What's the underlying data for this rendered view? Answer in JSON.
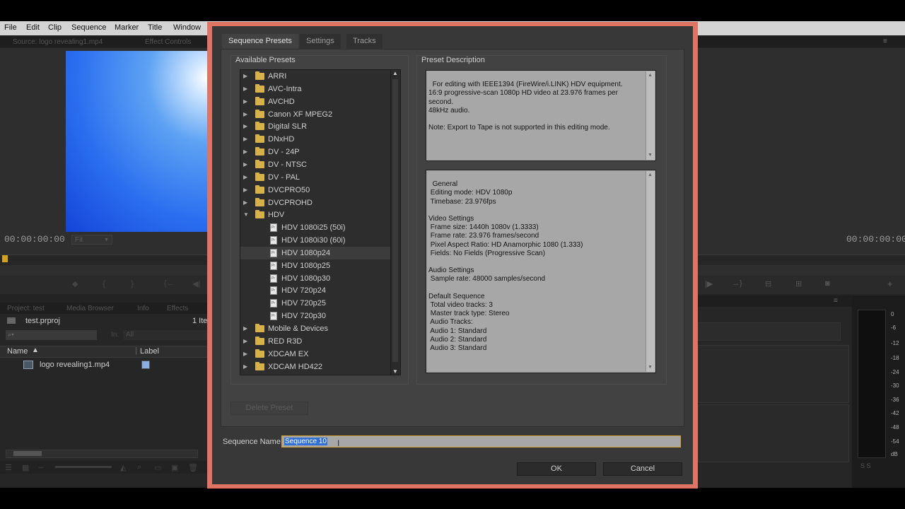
{
  "menubar": {
    "items": [
      "File",
      "Edit",
      "Clip",
      "Sequence",
      "Marker",
      "Title",
      "Window"
    ]
  },
  "source_panel": {
    "tab": "Source: logo revealing1.mp4",
    "tab2": "Effect Controls",
    "timecode": "00:00:00:00",
    "fit": "Fit"
  },
  "program_panel": {
    "timecode": "00:00:00:00"
  },
  "project_panel": {
    "tabs": [
      "Project: test",
      "Media Browser",
      "Info",
      "Effects"
    ],
    "project_file": "test.prproj",
    "item_count": "1 Ite",
    "in_label": "In:",
    "in_value": "All",
    "col_name": "Name",
    "col_label": "Label",
    "items": [
      {
        "name": "logo revealing1.mp4",
        "label_color": "#8aaee6"
      }
    ]
  },
  "meter": {
    "ticks": [
      "0",
      "-6",
      "-12",
      "-18",
      "-24",
      "-30",
      "-36",
      "-42",
      "-48",
      "-54",
      "dB"
    ]
  },
  "dialog": {
    "tabs": [
      "Sequence Presets",
      "Settings",
      "Tracks"
    ],
    "available_presets_label": "Available Presets",
    "preset_description_label": "Preset Description",
    "tree": [
      {
        "label": "ARRI",
        "kind": "folder",
        "expanded": false
      },
      {
        "label": "AVC-Intra",
        "kind": "folder",
        "expanded": false
      },
      {
        "label": "AVCHD",
        "kind": "folder",
        "expanded": false
      },
      {
        "label": "Canon XF MPEG2",
        "kind": "folder",
        "expanded": false
      },
      {
        "label": "Digital SLR",
        "kind": "folder",
        "expanded": false
      },
      {
        "label": "DNxHD",
        "kind": "folder",
        "expanded": false
      },
      {
        "label": "DV - 24P",
        "kind": "folder",
        "expanded": false
      },
      {
        "label": "DV - NTSC",
        "kind": "folder",
        "expanded": false
      },
      {
        "label": "DV - PAL",
        "kind": "folder",
        "expanded": false
      },
      {
        "label": "DVCPRO50",
        "kind": "folder",
        "expanded": false
      },
      {
        "label": "DVCPROHD",
        "kind": "folder",
        "expanded": false
      },
      {
        "label": "HDV",
        "kind": "folder",
        "expanded": true
      },
      {
        "label": "HDV 1080i25 (50i)",
        "kind": "preset"
      },
      {
        "label": "HDV 1080i30 (60i)",
        "kind": "preset"
      },
      {
        "label": "HDV 1080p24",
        "kind": "preset",
        "selected": true
      },
      {
        "label": "HDV 1080p25",
        "kind": "preset"
      },
      {
        "label": "HDV 1080p30",
        "kind": "preset"
      },
      {
        "label": "HDV 720p24",
        "kind": "preset"
      },
      {
        "label": "HDV 720p25",
        "kind": "preset"
      },
      {
        "label": "HDV 720p30",
        "kind": "preset"
      },
      {
        "label": "Mobile & Devices",
        "kind": "folder",
        "expanded": false
      },
      {
        "label": "RED R3D",
        "kind": "folder",
        "expanded": false
      },
      {
        "label": "XDCAM EX",
        "kind": "folder",
        "expanded": false
      },
      {
        "label": "XDCAM HD422",
        "kind": "folder",
        "expanded": false
      }
    ],
    "description": "For editing with IEEE1394 (FireWire/i.LINK) HDV equipment.\n16:9 progressive-scan 1080p HD video at 23.976 frames per\nsecond.\n48kHz audio.\n\nNote: Export to Tape is not supported in this editing mode.",
    "details": "General\n Editing mode: HDV 1080p\n Timebase: 23.976fps\n\nVideo Settings\n Frame size: 1440h 1080v (1.3333)\n Frame rate: 23.976 frames/second\n Pixel Aspect Ratio: HD Anamorphic 1080 (1.333)\n Fields: No Fields (Progressive Scan)\n\nAudio Settings\n Sample rate: 48000 samples/second\n\nDefault Sequence\n Total video tracks: 3\n Master track type: Stereo\n Audio Tracks:\n Audio 1: Standard\n Audio 2: Standard\n Audio 3: Standard",
    "delete_preset": "Delete Preset",
    "sequence_name_label": "Sequence Name:",
    "sequence_name_value": "Sequence 10",
    "ok": "OK",
    "cancel": "Cancel",
    "border_color": "#e07464"
  }
}
